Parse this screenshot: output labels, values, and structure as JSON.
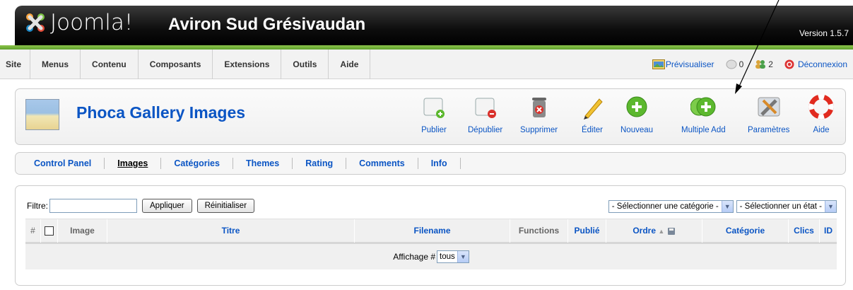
{
  "header": {
    "logo_text": "Joomla!",
    "site_name": "Aviron Sud Grésivaudan",
    "version": "Version 1.5.7"
  },
  "menu": {
    "items": [
      "Site",
      "Menus",
      "Contenu",
      "Composants",
      "Extensions",
      "Outils",
      "Aide"
    ],
    "preview_label": "Prévisualiser",
    "messages_count": "0",
    "users_count": "2",
    "logout_label": "Déconnexion"
  },
  "toolbar": {
    "title": "Phoca Gallery Images",
    "buttons": [
      "Publier",
      "Dépublier",
      "Supprimer",
      "Éditer",
      "Nouveau",
      "Multiple Add",
      "Paramètres",
      "Aide"
    ]
  },
  "submenu": {
    "items": [
      "Control Panel",
      "Images",
      "Catégories",
      "Themes",
      "Rating",
      "Comments",
      "Info"
    ],
    "active": "Images"
  },
  "filter": {
    "label": "Filtre:",
    "value": "",
    "apply_label": "Appliquer",
    "reset_label": "Réinitialiser",
    "category_select": "- Sélectionner une catégorie -",
    "state_select": "- Sélectionner un état -"
  },
  "table": {
    "columns": [
      "#",
      "Image",
      "Titre",
      "Filename",
      "Functions",
      "Publié",
      "Ordre",
      "Catégorie",
      "Clics",
      "ID"
    ],
    "footer_label": "Affichage #",
    "page_size": "tous"
  },
  "colors": {
    "link_blue": "#0b55c4",
    "green_bar": "#6fae36"
  }
}
